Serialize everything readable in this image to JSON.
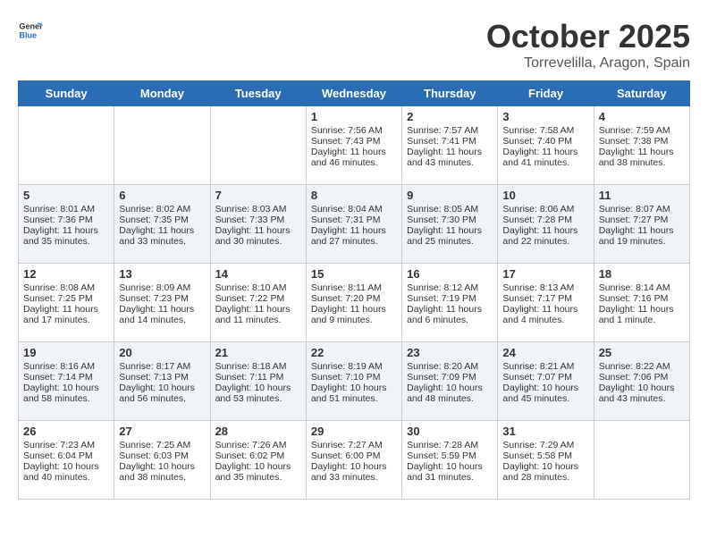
{
  "header": {
    "logo_general": "General",
    "logo_blue": "Blue",
    "month": "October 2025",
    "location": "Torrevelilla, Aragon, Spain"
  },
  "weekdays": [
    "Sunday",
    "Monday",
    "Tuesday",
    "Wednesday",
    "Thursday",
    "Friday",
    "Saturday"
  ],
  "weeks": [
    [
      {
        "day": "",
        "content": ""
      },
      {
        "day": "",
        "content": ""
      },
      {
        "day": "",
        "content": ""
      },
      {
        "day": "1",
        "content": "Sunrise: 7:56 AM\nSunset: 7:43 PM\nDaylight: 11 hours\nand 46 minutes."
      },
      {
        "day": "2",
        "content": "Sunrise: 7:57 AM\nSunset: 7:41 PM\nDaylight: 11 hours\nand 43 minutes."
      },
      {
        "day": "3",
        "content": "Sunrise: 7:58 AM\nSunset: 7:40 PM\nDaylight: 11 hours\nand 41 minutes."
      },
      {
        "day": "4",
        "content": "Sunrise: 7:59 AM\nSunset: 7:38 PM\nDaylight: 11 hours\nand 38 minutes."
      }
    ],
    [
      {
        "day": "5",
        "content": "Sunrise: 8:01 AM\nSunset: 7:36 PM\nDaylight: 11 hours\nand 35 minutes."
      },
      {
        "day": "6",
        "content": "Sunrise: 8:02 AM\nSunset: 7:35 PM\nDaylight: 11 hours\nand 33 minutes."
      },
      {
        "day": "7",
        "content": "Sunrise: 8:03 AM\nSunset: 7:33 PM\nDaylight: 11 hours\nand 30 minutes."
      },
      {
        "day": "8",
        "content": "Sunrise: 8:04 AM\nSunset: 7:31 PM\nDaylight: 11 hours\nand 27 minutes."
      },
      {
        "day": "9",
        "content": "Sunrise: 8:05 AM\nSunset: 7:30 PM\nDaylight: 11 hours\nand 25 minutes."
      },
      {
        "day": "10",
        "content": "Sunrise: 8:06 AM\nSunset: 7:28 PM\nDaylight: 11 hours\nand 22 minutes."
      },
      {
        "day": "11",
        "content": "Sunrise: 8:07 AM\nSunset: 7:27 PM\nDaylight: 11 hours\nand 19 minutes."
      }
    ],
    [
      {
        "day": "12",
        "content": "Sunrise: 8:08 AM\nSunset: 7:25 PM\nDaylight: 11 hours\nand 17 minutes."
      },
      {
        "day": "13",
        "content": "Sunrise: 8:09 AM\nSunset: 7:23 PM\nDaylight: 11 hours\nand 14 minutes."
      },
      {
        "day": "14",
        "content": "Sunrise: 8:10 AM\nSunset: 7:22 PM\nDaylight: 11 hours\nand 11 minutes."
      },
      {
        "day": "15",
        "content": "Sunrise: 8:11 AM\nSunset: 7:20 PM\nDaylight: 11 hours\nand 9 minutes."
      },
      {
        "day": "16",
        "content": "Sunrise: 8:12 AM\nSunset: 7:19 PM\nDaylight: 11 hours\nand 6 minutes."
      },
      {
        "day": "17",
        "content": "Sunrise: 8:13 AM\nSunset: 7:17 PM\nDaylight: 11 hours\nand 4 minutes."
      },
      {
        "day": "18",
        "content": "Sunrise: 8:14 AM\nSunset: 7:16 PM\nDaylight: 11 hours\nand 1 minute."
      }
    ],
    [
      {
        "day": "19",
        "content": "Sunrise: 8:16 AM\nSunset: 7:14 PM\nDaylight: 10 hours\nand 58 minutes."
      },
      {
        "day": "20",
        "content": "Sunrise: 8:17 AM\nSunset: 7:13 PM\nDaylight: 10 hours\nand 56 minutes."
      },
      {
        "day": "21",
        "content": "Sunrise: 8:18 AM\nSunset: 7:11 PM\nDaylight: 10 hours\nand 53 minutes."
      },
      {
        "day": "22",
        "content": "Sunrise: 8:19 AM\nSunset: 7:10 PM\nDaylight: 10 hours\nand 51 minutes."
      },
      {
        "day": "23",
        "content": "Sunrise: 8:20 AM\nSunset: 7:09 PM\nDaylight: 10 hours\nand 48 minutes."
      },
      {
        "day": "24",
        "content": "Sunrise: 8:21 AM\nSunset: 7:07 PM\nDaylight: 10 hours\nand 45 minutes."
      },
      {
        "day": "25",
        "content": "Sunrise: 8:22 AM\nSunset: 7:06 PM\nDaylight: 10 hours\nand 43 minutes."
      }
    ],
    [
      {
        "day": "26",
        "content": "Sunrise: 7:23 AM\nSunset: 6:04 PM\nDaylight: 10 hours\nand 40 minutes."
      },
      {
        "day": "27",
        "content": "Sunrise: 7:25 AM\nSunset: 6:03 PM\nDaylight: 10 hours\nand 38 minutes."
      },
      {
        "day": "28",
        "content": "Sunrise: 7:26 AM\nSunset: 6:02 PM\nDaylight: 10 hours\nand 35 minutes."
      },
      {
        "day": "29",
        "content": "Sunrise: 7:27 AM\nSunset: 6:00 PM\nDaylight: 10 hours\nand 33 minutes."
      },
      {
        "day": "30",
        "content": "Sunrise: 7:28 AM\nSunset: 5:59 PM\nDaylight: 10 hours\nand 31 minutes."
      },
      {
        "day": "31",
        "content": "Sunrise: 7:29 AM\nSunset: 5:58 PM\nDaylight: 10 hours\nand 28 minutes."
      },
      {
        "day": "",
        "content": ""
      }
    ]
  ]
}
